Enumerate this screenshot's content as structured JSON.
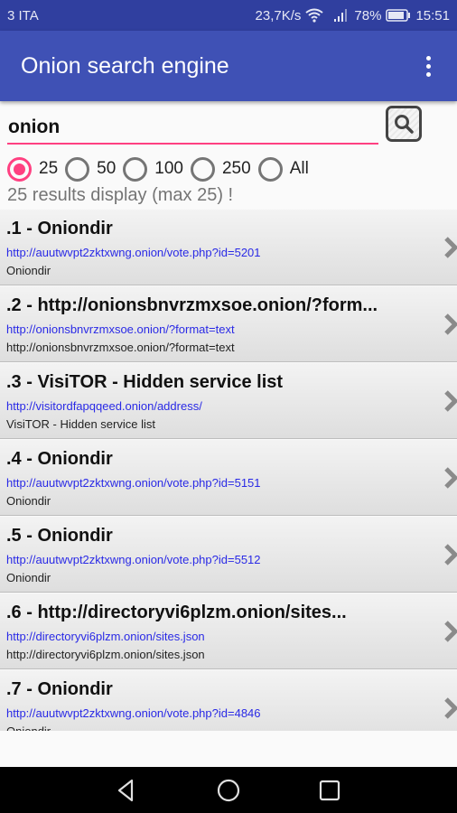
{
  "status_bar": {
    "carrier": "3 ITA",
    "network_speed": "23,7K/s",
    "battery": "78%",
    "battery_level_percent": 78,
    "time": "15:51"
  },
  "app_bar": {
    "title": "Onion search engine",
    "menu_icon": "more-vert-icon"
  },
  "search": {
    "value": "onion",
    "placeholder": "",
    "button_icon": "search-icon",
    "accent_color": "#ff4081"
  },
  "result_limits": {
    "options": [
      {
        "label": "25",
        "checked": true
      },
      {
        "label": "50",
        "checked": false
      },
      {
        "label": "100",
        "checked": false
      },
      {
        "label": "250",
        "checked": false
      },
      {
        "label": "All",
        "checked": false
      }
    ]
  },
  "results_info": "25 results display (max 25) !",
  "results": [
    {
      "title": ".1 - Oniondir",
      "url": "http://auutwvpt2zktxwng.onion/vote.php?id=5201",
      "description": "Oniondir"
    },
    {
      "title": ".2 - http://onionsbnvrzmxsoe.onion/?form...",
      "url": "http://onionsbnvrzmxsoe.onion/?format=text",
      "description": "http://onionsbnvrzmxsoe.onion/?format=text"
    },
    {
      "title": ".3 - VisiTOR - Hidden service list",
      "url": "http://visitordfapqqeed.onion/address/",
      "description": "VisiTOR - Hidden service list"
    },
    {
      "title": ".4 - Oniondir",
      "url": "http://auutwvpt2zktxwng.onion/vote.php?id=5151",
      "description": "Oniondir"
    },
    {
      "title": ".5 - Oniondir",
      "url": "http://auutwvpt2zktxwng.onion/vote.php?id=5512",
      "description": "Oniondir"
    },
    {
      "title": ".6 - http://directoryvi6plzm.onion/sites...",
      "url": "http://directoryvi6plzm.onion/sites.json",
      "description": "http://directoryvi6plzm.onion/sites.json"
    },
    {
      "title": ".7 - Oniondir",
      "url": "http://auutwvpt2zktxwng.onion/vote.php?id=4846",
      "description": "Oniondir"
    }
  ],
  "colors": {
    "primary": "#3f51b5",
    "primary_dark": "#303f9f",
    "accent": "#ff4081",
    "link": "#2a2ae6"
  },
  "nav_bar": {
    "back_icon": "back-icon",
    "home_icon": "home-icon",
    "recents_icon": "recents-icon"
  }
}
